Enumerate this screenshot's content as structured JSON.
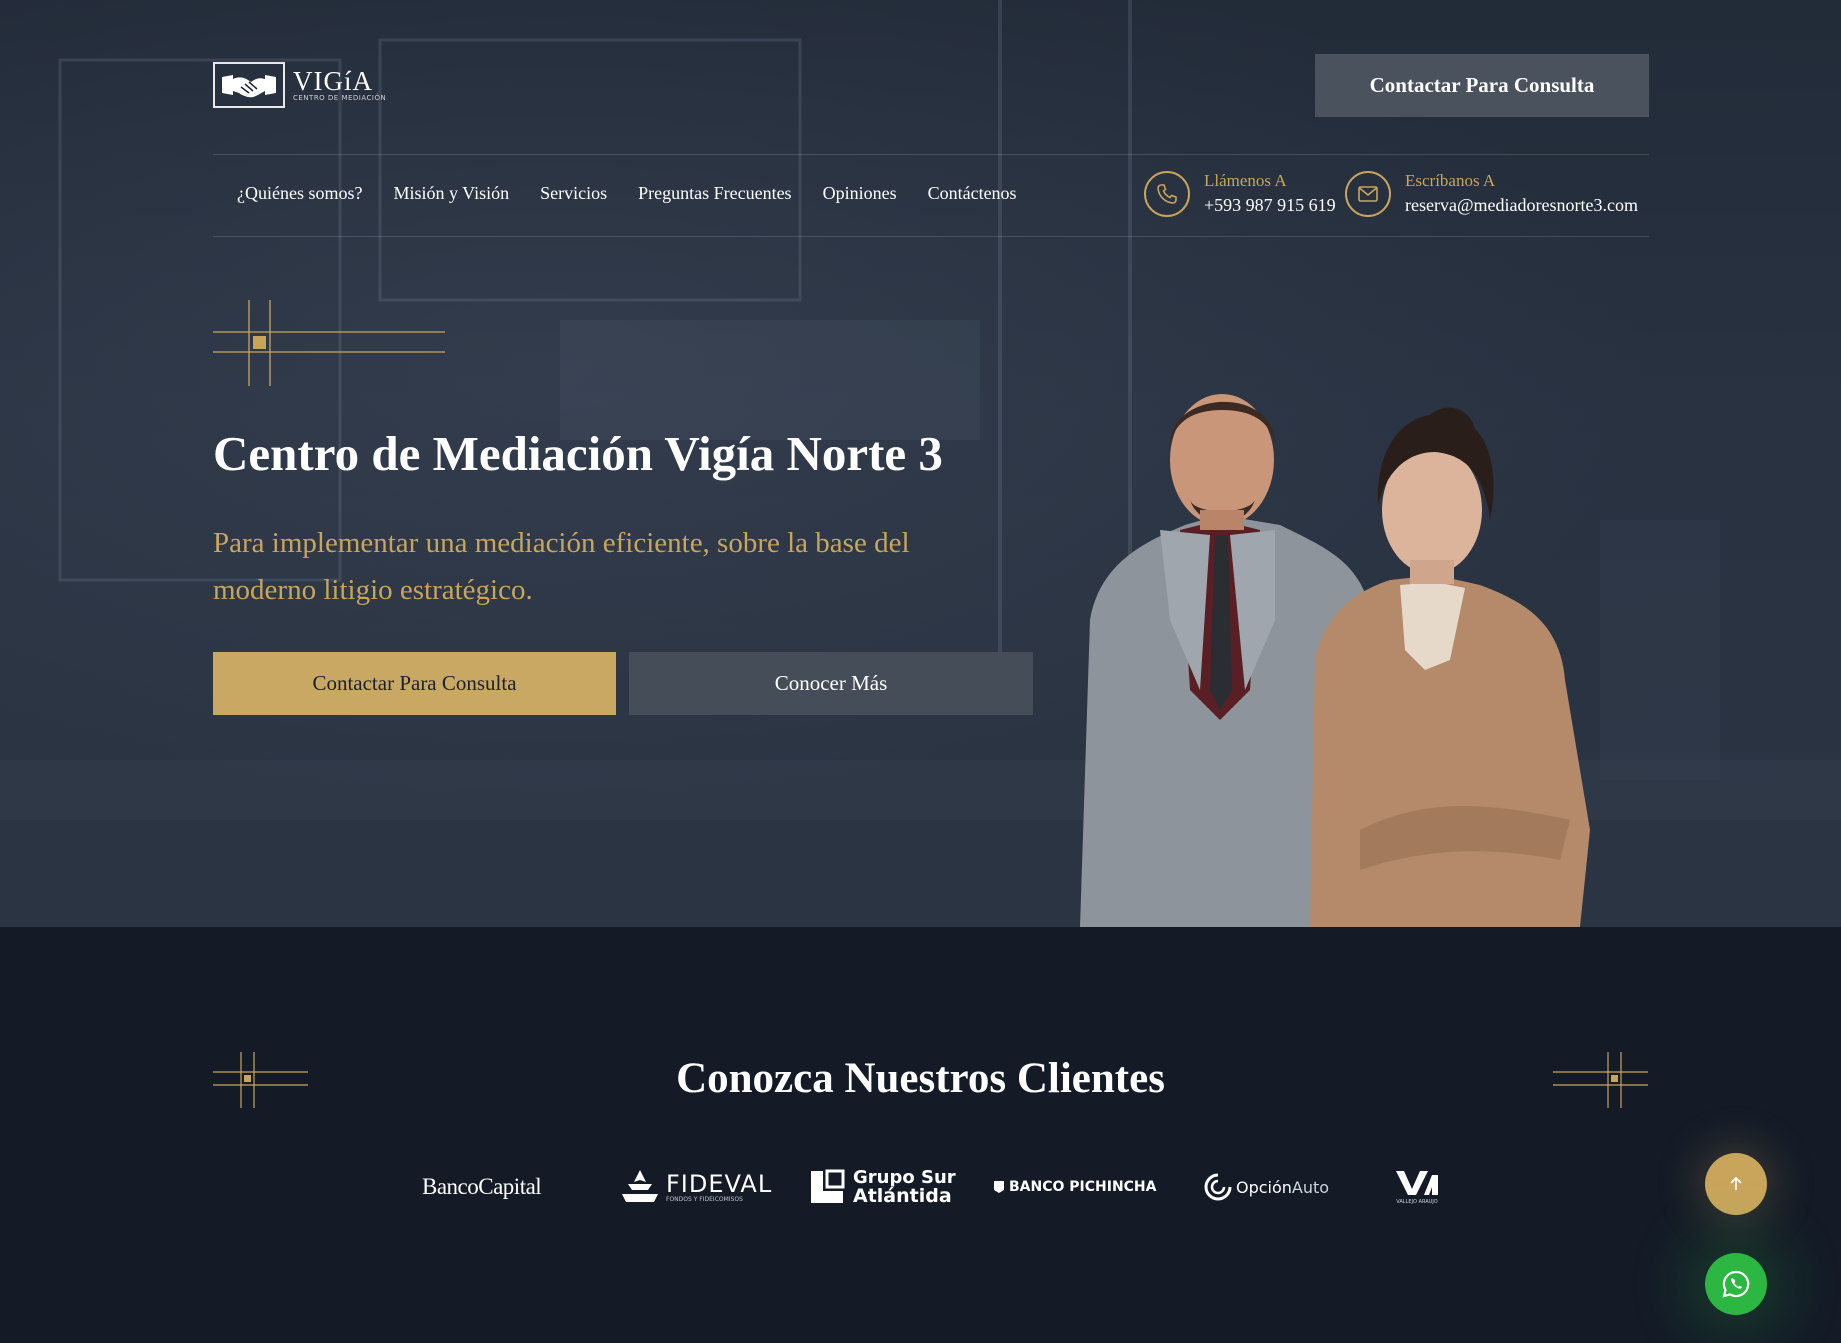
{
  "brand": {
    "name": "VIGíA",
    "tagline": "CENTRO DE MEDIACIÓN",
    "icon": "handshake-icon"
  },
  "header": {
    "cta_label": "Contactar Para Consulta"
  },
  "nav": {
    "items": [
      {
        "label": "¿Quiénes somos?"
      },
      {
        "label": "Misión y Visión"
      },
      {
        "label": "Servicios"
      },
      {
        "label": "Preguntas Frecuentes"
      },
      {
        "label": "Opiniones"
      },
      {
        "label": "Contáctenos"
      }
    ]
  },
  "contact": {
    "phone": {
      "label": "Llámenos A",
      "value": "+593 987 915 619",
      "icon": "phone-icon"
    },
    "email": {
      "label": "Escríbanos A",
      "value": "reserva@mediadoresnorte3.com",
      "icon": "mail-icon"
    }
  },
  "hero": {
    "title": "Centro de Mediación Vigía Norte 3",
    "subtitle": "Para implementar una mediación eficiente, sobre la base del moderno litigio estratégico.",
    "primary_button": "Contactar Para Consulta",
    "secondary_button": "Conocer Más"
  },
  "clients": {
    "title": "Conozca Nuestros Clientes",
    "logos": [
      {
        "name": "BancoCapital",
        "text": "BancoCapital"
      },
      {
        "name": "FIDEVAL",
        "text": "FIDEVAL",
        "sub": "FONDOS Y FIDEICOMISOS"
      },
      {
        "name": "Grupo Sur Atlántida",
        "text": "Grupo Sur",
        "text2": "Atlántida"
      },
      {
        "name": "BANCO PICHINCHA",
        "text": "BANCO PICHINCHA"
      },
      {
        "name": "OpciónAuto",
        "text": "Opción",
        "text2": "Auto"
      },
      {
        "name": "Vallejo Araujo",
        "text": "VA",
        "sub": "VALLEJO ARAUJO"
      }
    ]
  },
  "floating": {
    "scroll_top_icon": "arrow-up-icon",
    "whatsapp_icon": "whatsapp-icon"
  },
  "colors": {
    "accent": "#c9a55c",
    "hero_bg": "#283241",
    "page_bg": "#141b27",
    "whatsapp": "#2bb741"
  }
}
